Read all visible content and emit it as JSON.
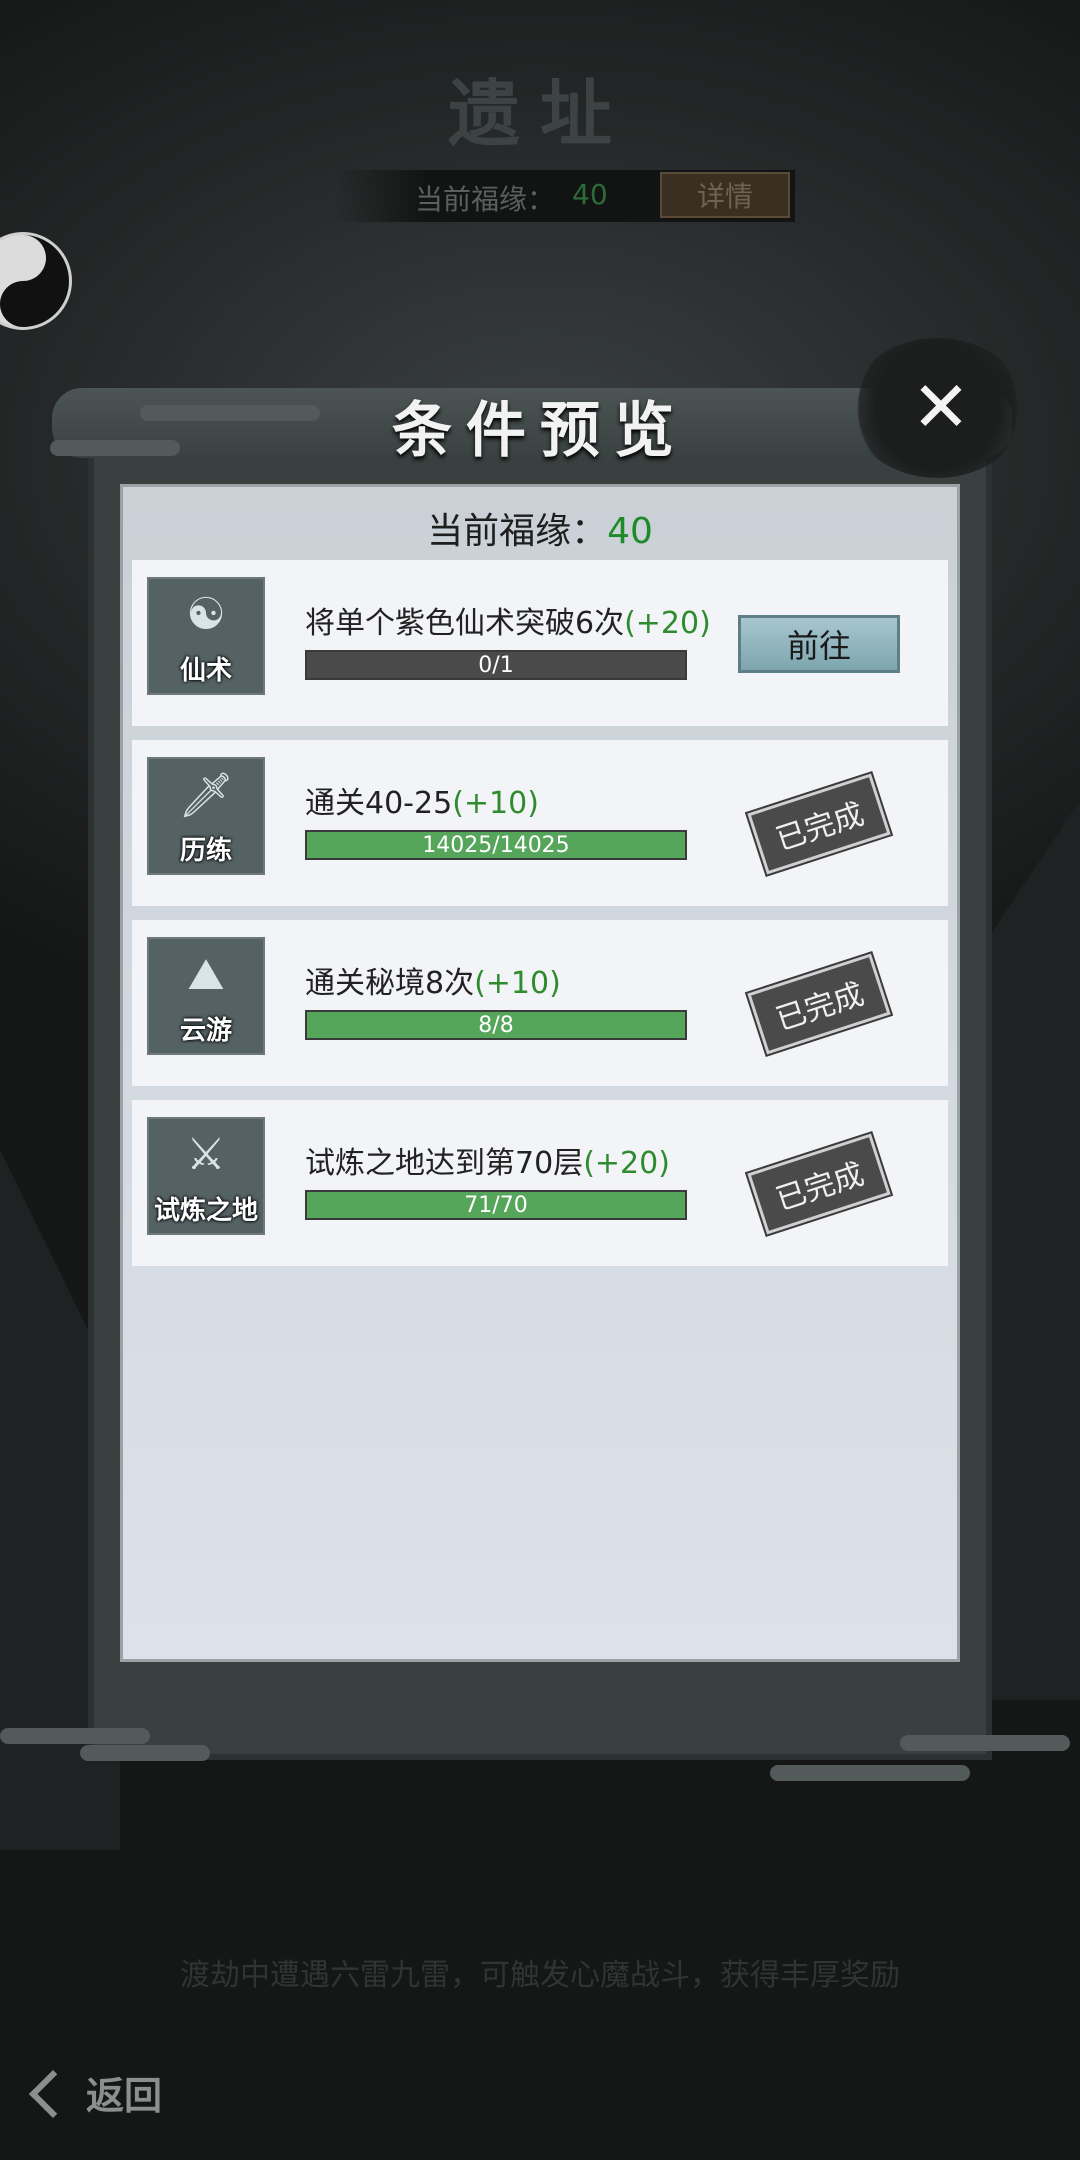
{
  "background": {
    "title": "遗址",
    "fortune_label": "当前福缘：",
    "fortune_value": "40",
    "detail_button": "详情",
    "description": "渡劫中遭遇六雷九雷，可触发心魔战斗，获得丰厚奖励",
    "back_label": "返回"
  },
  "dialog": {
    "title": "条件预览",
    "close_icon": "close-icon",
    "fortune_label": "当前福缘：",
    "fortune_value": "40",
    "tasks": [
      {
        "icon": "spell-icon",
        "icon_label": "仙术",
        "title": "将单个紫色仙术突破6次",
        "bonus": "(+20)",
        "progress_text": "0/1",
        "progress": 0,
        "action": "前往"
      },
      {
        "icon": "sword-icon",
        "icon_label": "历练",
        "title": "通关40-25",
        "bonus": "(+10)",
        "progress_text": "14025/14025",
        "progress": 1,
        "status": "已完成"
      },
      {
        "icon": "mountain-cloud-icon",
        "icon_label": "云游",
        "title": "通关秘境8次",
        "bonus": "(+10)",
        "progress_text": "8/8",
        "progress": 1,
        "status": "已完成"
      },
      {
        "icon": "tower-sword-icon",
        "icon_label": "试炼之地",
        "title": "试炼之地达到第70层",
        "bonus": "(+20)",
        "progress_text": "71/70",
        "progress": 1,
        "status": "已完成"
      }
    ]
  }
}
